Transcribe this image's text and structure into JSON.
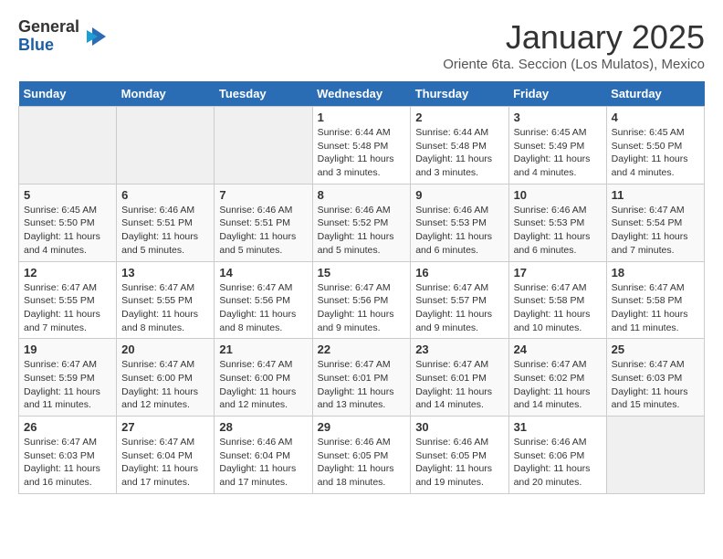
{
  "logo": {
    "general": "General",
    "blue": "Blue"
  },
  "title": "January 2025",
  "subtitle": "Oriente 6ta. Seccion (Los Mulatos), Mexico",
  "days_of_week": [
    "Sunday",
    "Monday",
    "Tuesday",
    "Wednesday",
    "Thursday",
    "Friday",
    "Saturday"
  ],
  "weeks": [
    [
      {
        "day": "",
        "info": ""
      },
      {
        "day": "",
        "info": ""
      },
      {
        "day": "",
        "info": ""
      },
      {
        "day": "1",
        "info": "Sunrise: 6:44 AM\nSunset: 5:48 PM\nDaylight: 11 hours\nand 3 minutes."
      },
      {
        "day": "2",
        "info": "Sunrise: 6:44 AM\nSunset: 5:48 PM\nDaylight: 11 hours\nand 3 minutes."
      },
      {
        "day": "3",
        "info": "Sunrise: 6:45 AM\nSunset: 5:49 PM\nDaylight: 11 hours\nand 4 minutes."
      },
      {
        "day": "4",
        "info": "Sunrise: 6:45 AM\nSunset: 5:50 PM\nDaylight: 11 hours\nand 4 minutes."
      }
    ],
    [
      {
        "day": "5",
        "info": "Sunrise: 6:45 AM\nSunset: 5:50 PM\nDaylight: 11 hours\nand 4 minutes."
      },
      {
        "day": "6",
        "info": "Sunrise: 6:46 AM\nSunset: 5:51 PM\nDaylight: 11 hours\nand 5 minutes."
      },
      {
        "day": "7",
        "info": "Sunrise: 6:46 AM\nSunset: 5:51 PM\nDaylight: 11 hours\nand 5 minutes."
      },
      {
        "day": "8",
        "info": "Sunrise: 6:46 AM\nSunset: 5:52 PM\nDaylight: 11 hours\nand 5 minutes."
      },
      {
        "day": "9",
        "info": "Sunrise: 6:46 AM\nSunset: 5:53 PM\nDaylight: 11 hours\nand 6 minutes."
      },
      {
        "day": "10",
        "info": "Sunrise: 6:46 AM\nSunset: 5:53 PM\nDaylight: 11 hours\nand 6 minutes."
      },
      {
        "day": "11",
        "info": "Sunrise: 6:47 AM\nSunset: 5:54 PM\nDaylight: 11 hours\nand 7 minutes."
      }
    ],
    [
      {
        "day": "12",
        "info": "Sunrise: 6:47 AM\nSunset: 5:55 PM\nDaylight: 11 hours\nand 7 minutes."
      },
      {
        "day": "13",
        "info": "Sunrise: 6:47 AM\nSunset: 5:55 PM\nDaylight: 11 hours\nand 8 minutes."
      },
      {
        "day": "14",
        "info": "Sunrise: 6:47 AM\nSunset: 5:56 PM\nDaylight: 11 hours\nand 8 minutes."
      },
      {
        "day": "15",
        "info": "Sunrise: 6:47 AM\nSunset: 5:56 PM\nDaylight: 11 hours\nand 9 minutes."
      },
      {
        "day": "16",
        "info": "Sunrise: 6:47 AM\nSunset: 5:57 PM\nDaylight: 11 hours\nand 9 minutes."
      },
      {
        "day": "17",
        "info": "Sunrise: 6:47 AM\nSunset: 5:58 PM\nDaylight: 11 hours\nand 10 minutes."
      },
      {
        "day": "18",
        "info": "Sunrise: 6:47 AM\nSunset: 5:58 PM\nDaylight: 11 hours\nand 11 minutes."
      }
    ],
    [
      {
        "day": "19",
        "info": "Sunrise: 6:47 AM\nSunset: 5:59 PM\nDaylight: 11 hours\nand 11 minutes."
      },
      {
        "day": "20",
        "info": "Sunrise: 6:47 AM\nSunset: 6:00 PM\nDaylight: 11 hours\nand 12 minutes."
      },
      {
        "day": "21",
        "info": "Sunrise: 6:47 AM\nSunset: 6:00 PM\nDaylight: 11 hours\nand 12 minutes."
      },
      {
        "day": "22",
        "info": "Sunrise: 6:47 AM\nSunset: 6:01 PM\nDaylight: 11 hours\nand 13 minutes."
      },
      {
        "day": "23",
        "info": "Sunrise: 6:47 AM\nSunset: 6:01 PM\nDaylight: 11 hours\nand 14 minutes."
      },
      {
        "day": "24",
        "info": "Sunrise: 6:47 AM\nSunset: 6:02 PM\nDaylight: 11 hours\nand 14 minutes."
      },
      {
        "day": "25",
        "info": "Sunrise: 6:47 AM\nSunset: 6:03 PM\nDaylight: 11 hours\nand 15 minutes."
      }
    ],
    [
      {
        "day": "26",
        "info": "Sunrise: 6:47 AM\nSunset: 6:03 PM\nDaylight: 11 hours\nand 16 minutes."
      },
      {
        "day": "27",
        "info": "Sunrise: 6:47 AM\nSunset: 6:04 PM\nDaylight: 11 hours\nand 17 minutes."
      },
      {
        "day": "28",
        "info": "Sunrise: 6:46 AM\nSunset: 6:04 PM\nDaylight: 11 hours\nand 17 minutes."
      },
      {
        "day": "29",
        "info": "Sunrise: 6:46 AM\nSunset: 6:05 PM\nDaylight: 11 hours\nand 18 minutes."
      },
      {
        "day": "30",
        "info": "Sunrise: 6:46 AM\nSunset: 6:05 PM\nDaylight: 11 hours\nand 19 minutes."
      },
      {
        "day": "31",
        "info": "Sunrise: 6:46 AM\nSunset: 6:06 PM\nDaylight: 11 hours\nand 20 minutes."
      },
      {
        "day": "",
        "info": ""
      }
    ]
  ]
}
